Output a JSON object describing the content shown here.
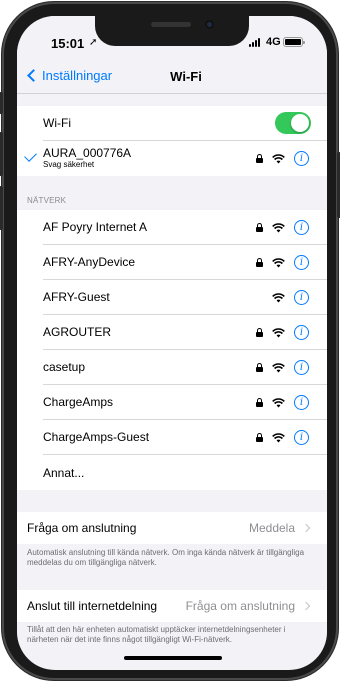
{
  "status_bar": {
    "time": "15:01",
    "location_glyph": "➚",
    "network": "4G"
  },
  "nav": {
    "back_label": "Inställningar",
    "title": "Wi-Fi"
  },
  "wifi": {
    "label": "Wi-Fi",
    "enabled": true,
    "toggle_color": "#34c759",
    "connected": {
      "name": "AURA_000776A",
      "subtitle": "Svag säkerhet",
      "secured": true
    }
  },
  "networks": {
    "header": "NÄTVERK",
    "items": [
      {
        "name": "AF Poyry Internet A",
        "secured": true
      },
      {
        "name": "AFRY-AnyDevice",
        "secured": true
      },
      {
        "name": "AFRY-Guest",
        "secured": false
      },
      {
        "name": "AGROUTER",
        "secured": true
      },
      {
        "name": "casetup",
        "secured": true
      },
      {
        "name": "ChargeAmps",
        "secured": true
      },
      {
        "name": "ChargeAmps-Guest",
        "secured": true
      }
    ],
    "other_label": "Annat..."
  },
  "ask_to_join": {
    "label": "Fråga om anslutning",
    "value": "Meddela",
    "footnote": "Automatisk anslutning till kända nätverk. Om inga kända nätverk är tillgängliga meddelas du om tillgängliga nätverk."
  },
  "hotspot": {
    "label": "Anslut till internetdelning",
    "value": "Fråga om anslutning",
    "footnote": "Tillåt att den här enheten automatiskt upptäcker internetdelningsenheter i närheten när det inte finns något tillgängligt Wi-Fi-nätverk."
  },
  "colors": {
    "accent": "#007aff",
    "background": "#f2f2f7"
  },
  "icons": {
    "info": "i",
    "wifi": "wifi-icon",
    "lock": "lock-icon"
  }
}
